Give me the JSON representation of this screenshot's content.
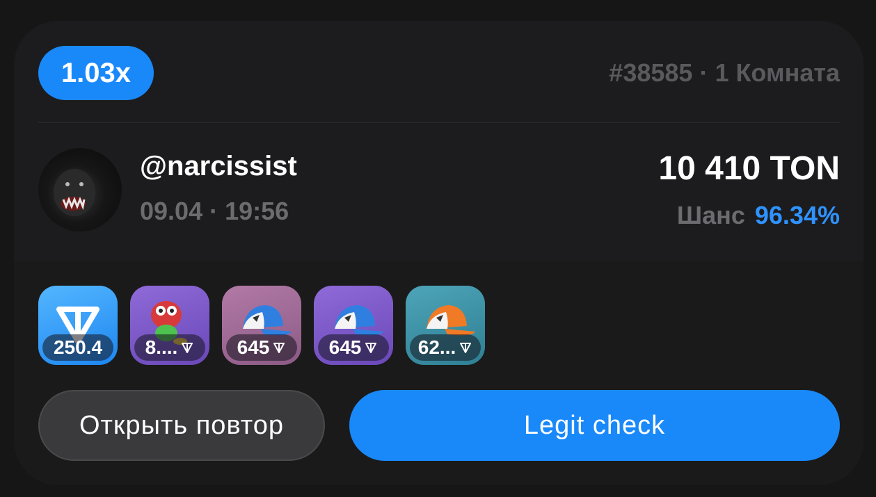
{
  "header": {
    "multiplier": "1.03x",
    "room_id": "#38585",
    "separator": "·",
    "room_label": "1 Комната"
  },
  "user": {
    "username": "@narcissist",
    "date": "09.04",
    "separator": "·",
    "time": "19:56",
    "amount": "10 410 TON",
    "chance_label": "Шанс",
    "chance_value": "96.34%"
  },
  "items": [
    {
      "name": "ton-coin",
      "price": "250.4",
      "show_ton_icon": false,
      "bg": "#2c93f8"
    },
    {
      "name": "frog-gift",
      "price": "8....",
      "show_ton_icon": true,
      "bg": "#7a58c8"
    },
    {
      "name": "cap-gift",
      "price": "645",
      "show_ton_icon": true,
      "bg": "#a06a96"
    },
    {
      "name": "cap-gift",
      "price": "645",
      "show_ton_icon": true,
      "bg": "#7a58c8"
    },
    {
      "name": "cap-orange-gift",
      "price": "62...",
      "show_ton_icon": true,
      "bg": "#3e92a6"
    }
  ],
  "actions": {
    "replay_label": "Открыть повтор",
    "legit_label": "Legit check"
  },
  "colors": {
    "accent": "#1989fa",
    "chance": "#2f93ff",
    "muted": "#6c6c70"
  }
}
